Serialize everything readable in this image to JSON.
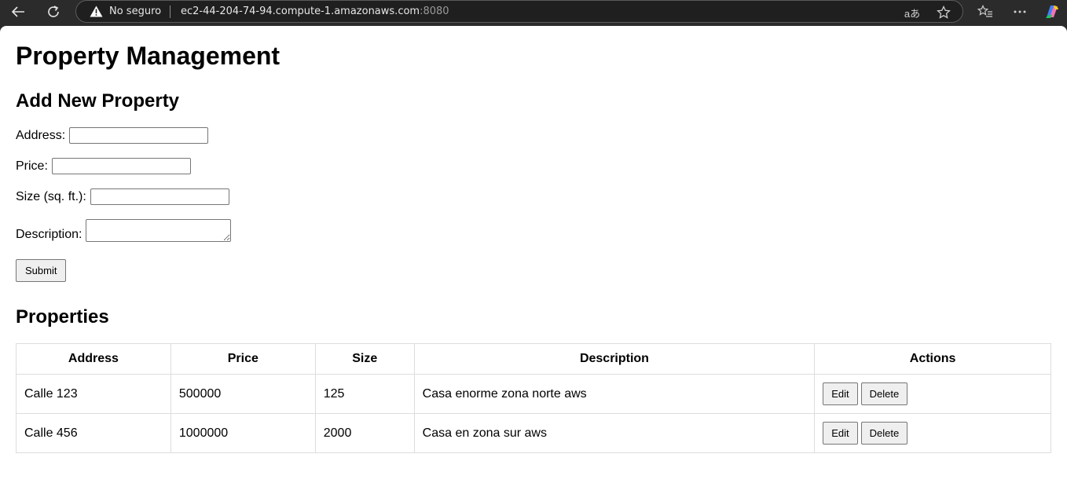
{
  "browser": {
    "security_label": "No seguro",
    "url_host": "ec2-44-204-74-94.compute-1.amazonaws.com",
    "url_port": ":8080",
    "translate_label": "aあ"
  },
  "page": {
    "title": "Property Management",
    "form": {
      "heading": "Add New Property",
      "address_label": "Address:",
      "price_label": "Price:",
      "size_label": "Size (sq. ft.):",
      "description_label": "Description:",
      "address_value": "",
      "price_value": "",
      "size_value": "",
      "description_value": "",
      "submit_label": "Submit"
    },
    "properties": {
      "heading": "Properties",
      "columns": [
        "Address",
        "Price",
        "Size",
        "Description",
        "Actions"
      ],
      "rows": [
        {
          "address": "Calle 123",
          "price": "500000",
          "size": "125",
          "description": "Casa enorme zona norte aws",
          "edit_label": "Edit",
          "delete_label": "Delete"
        },
        {
          "address": "Calle 456",
          "price": "1000000",
          "size": "2000",
          "description": "Casa en zona sur aws",
          "edit_label": "Edit",
          "delete_label": "Delete"
        }
      ]
    }
  }
}
